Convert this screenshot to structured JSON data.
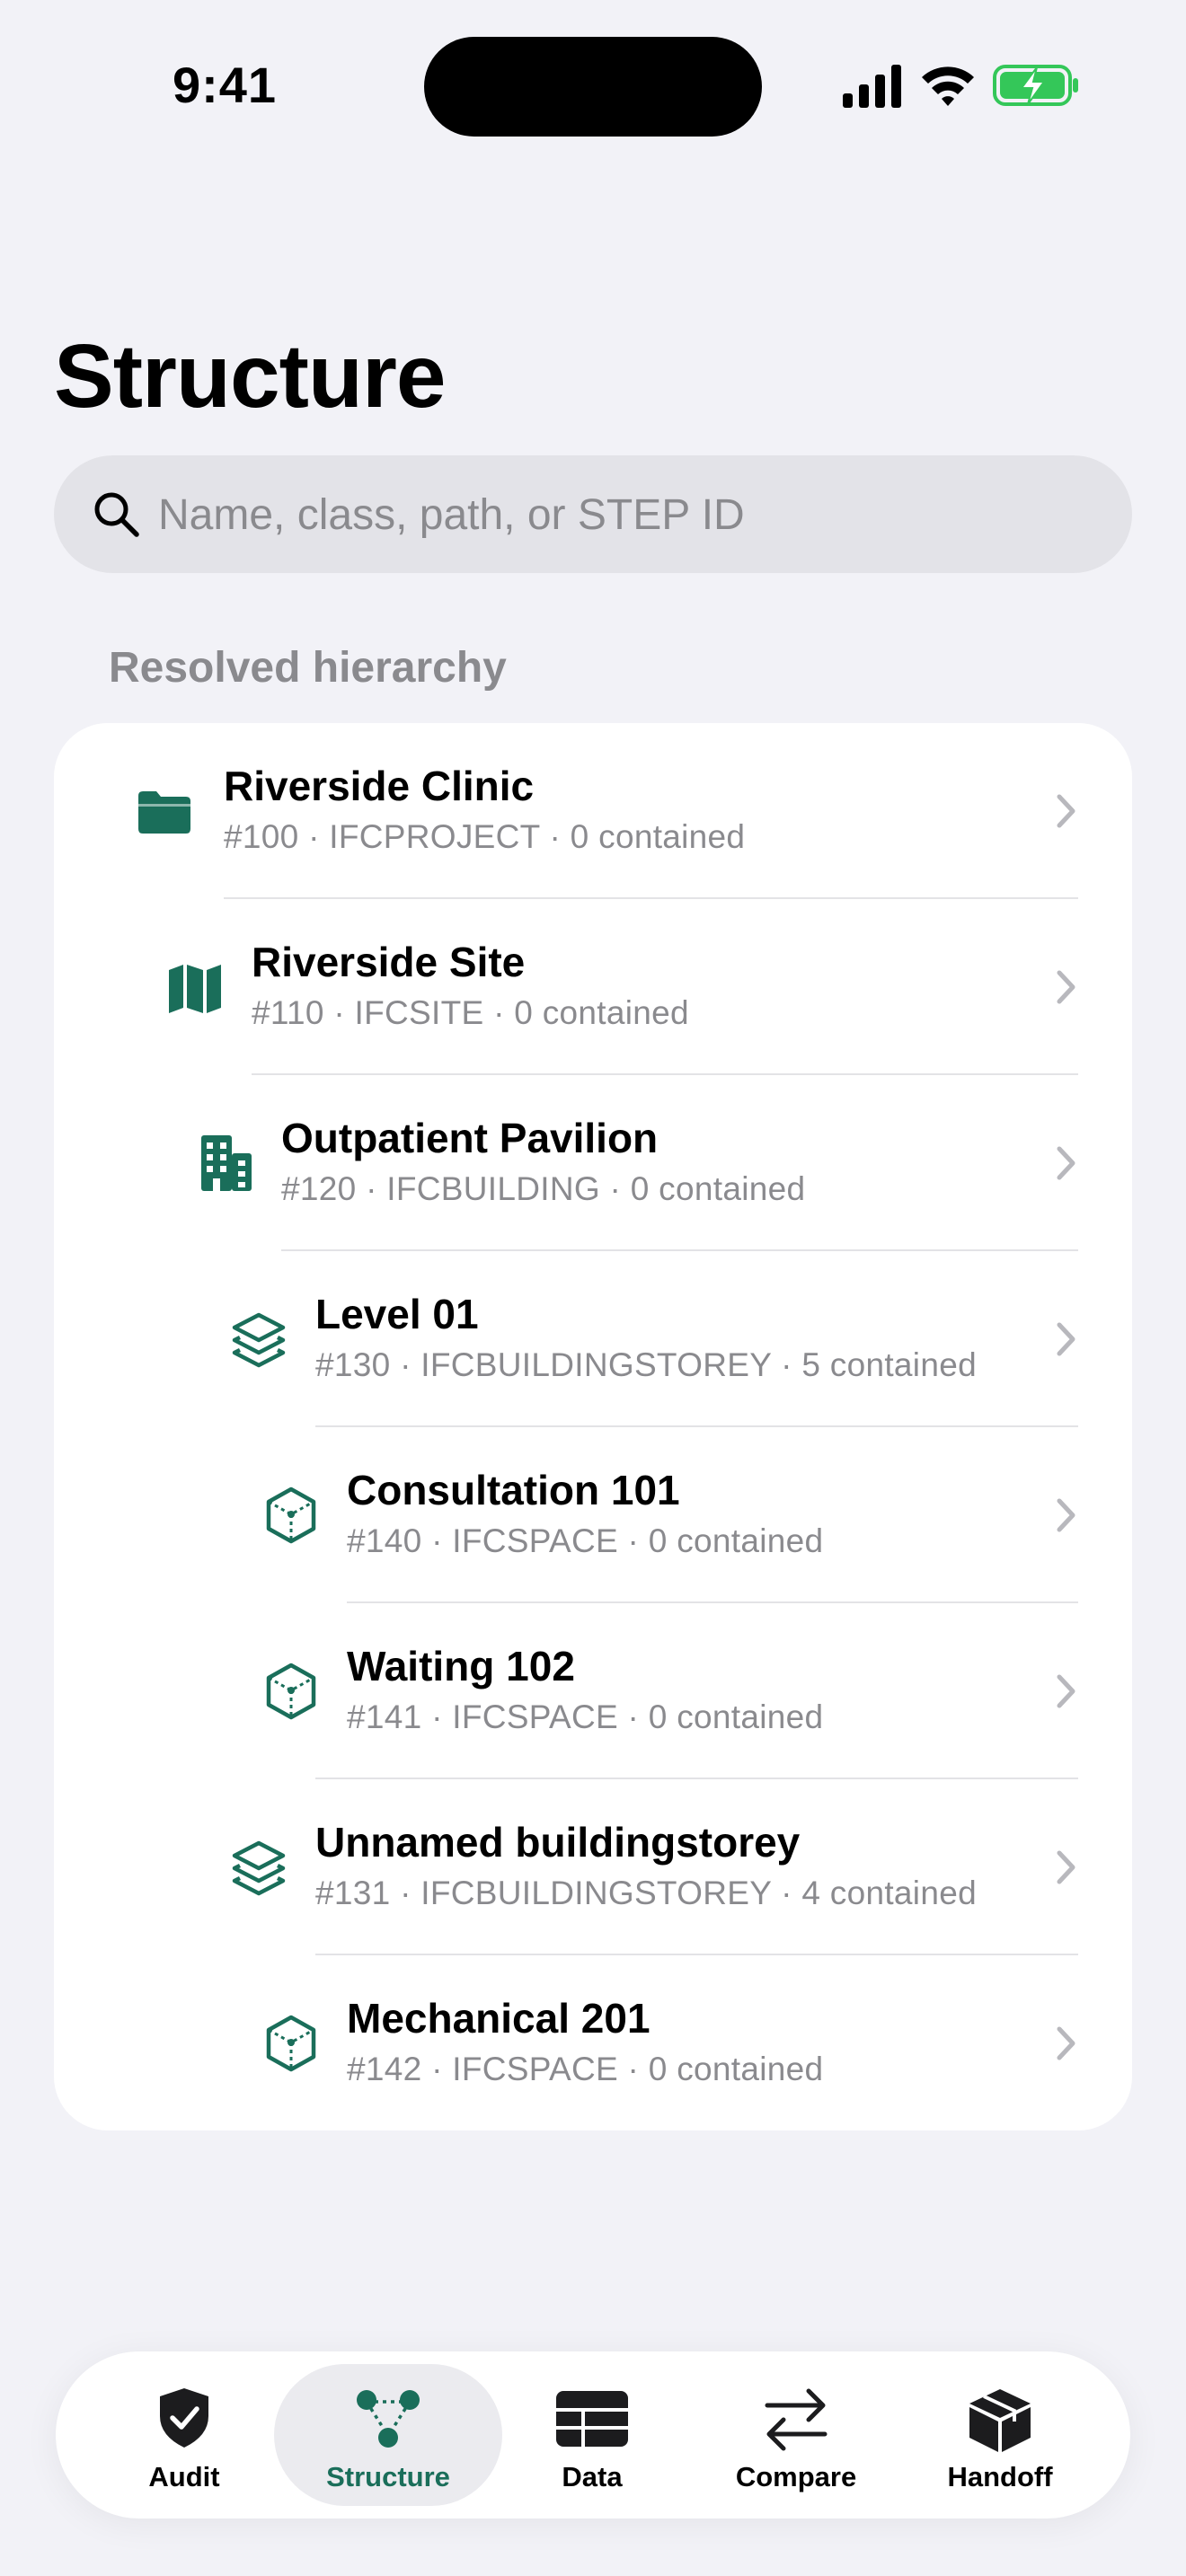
{
  "status_bar": {
    "time": "9:41"
  },
  "page": {
    "title": "Structure"
  },
  "search": {
    "placeholder": "Name, class, path, or STEP ID",
    "value": ""
  },
  "section": {
    "header": "Resolved hierarchy"
  },
  "colors": {
    "accent": "#1a6e5a",
    "background": "#f2f2f7",
    "secondary_text": "#8a8a8e"
  },
  "hierarchy": [
    {
      "name": "Riverside Clinic",
      "meta": "#100 · IFCPROJECT · 0 contained",
      "icon": "folder-icon"
    },
    {
      "name": "Riverside Site",
      "meta": "#110 · IFCSITE · 0 contained",
      "icon": "map-icon"
    },
    {
      "name": "Outpatient Pavilion",
      "meta": "#120 · IFCBUILDING · 0 contained",
      "icon": "building-icon"
    },
    {
      "name": "Level 01",
      "meta": "#130 · IFCBUILDINGSTOREY · 5 contained",
      "icon": "layers-icon"
    },
    {
      "name": "Consultation 101",
      "meta": "#140 · IFCSPACE · 0 contained",
      "icon": "space-cube-icon"
    },
    {
      "name": "Waiting 102",
      "meta": "#141 · IFCSPACE · 0 contained",
      "icon": "space-cube-icon"
    },
    {
      "name": "Unnamed buildingstorey",
      "meta": "#131 · IFCBUILDINGSTOREY · 4 contained",
      "icon": "layers-icon"
    },
    {
      "name": "Mechanical 201",
      "meta": "#142 · IFCSPACE · 0 contained",
      "icon": "space-cube-icon"
    }
  ],
  "tabs": [
    {
      "label": "Audit",
      "icon": "shield-check-icon",
      "active": false
    },
    {
      "label": "Structure",
      "icon": "graph-nodes-icon",
      "active": true
    },
    {
      "label": "Data",
      "icon": "table-icon",
      "active": false
    },
    {
      "label": "Compare",
      "icon": "arrows-swap-icon",
      "active": false
    },
    {
      "label": "Handoff",
      "icon": "package-box-icon",
      "active": false
    }
  ]
}
